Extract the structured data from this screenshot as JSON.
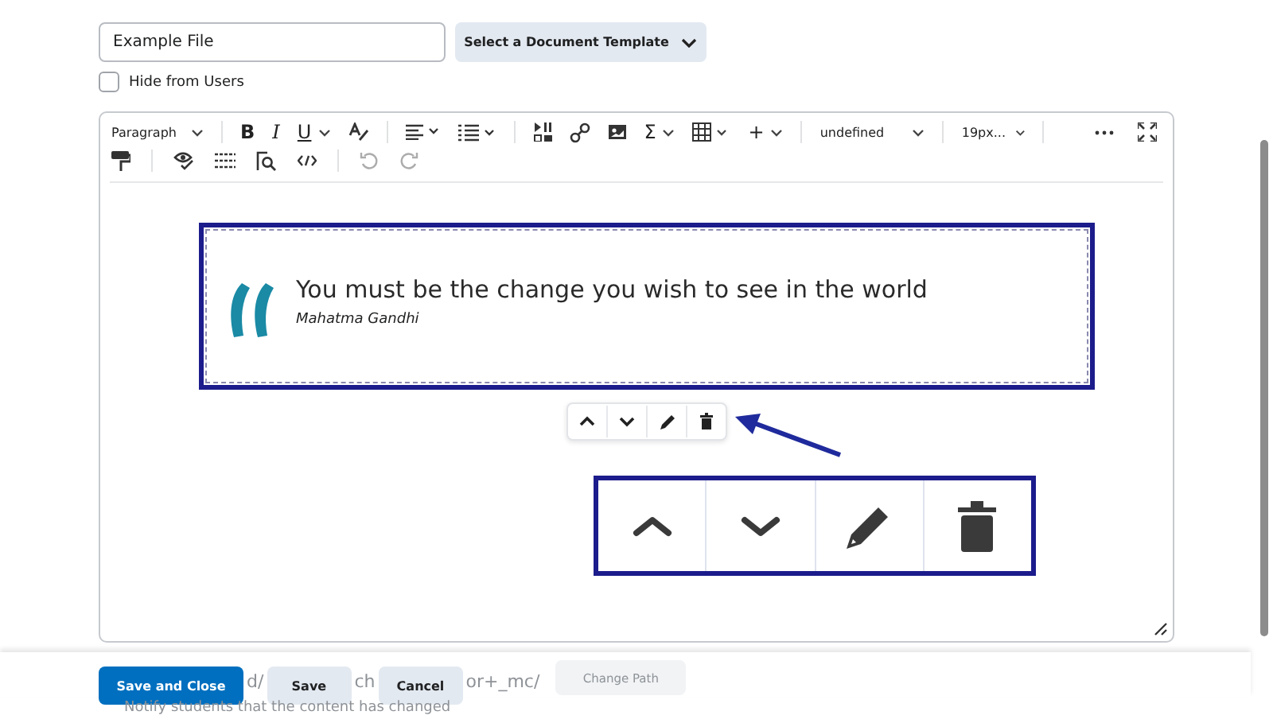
{
  "file_name": {
    "value": "Example File"
  },
  "template_button": {
    "label": "Select a Document Template"
  },
  "hide_from_users": {
    "label": "Hide from Users",
    "checked": false
  },
  "editor": {
    "block_format": "Paragraph",
    "bold": "B",
    "italic": "I",
    "underline": "U",
    "formula": "Σ",
    "insert": "+",
    "font_family": "undefined",
    "font_size": "19px...",
    "undo": {
      "disabled": true
    },
    "redo": {
      "disabled": true
    }
  },
  "quote": {
    "text": "You must be the change you wish to see in the world",
    "author": "Mahatma Gandhi"
  },
  "behind_footer": {
    "path_parts": [
      "d/",
      "ch",
      "or+_mc/"
    ],
    "change_path": "Change Path",
    "notify": "Notify students that the content has changed"
  },
  "footer": {
    "buttons": [
      {
        "label": "Save and Close",
        "kind": "primary"
      },
      {
        "label": "Save",
        "kind": "secondary"
      },
      {
        "label": "Cancel",
        "kind": "secondary"
      }
    ]
  }
}
